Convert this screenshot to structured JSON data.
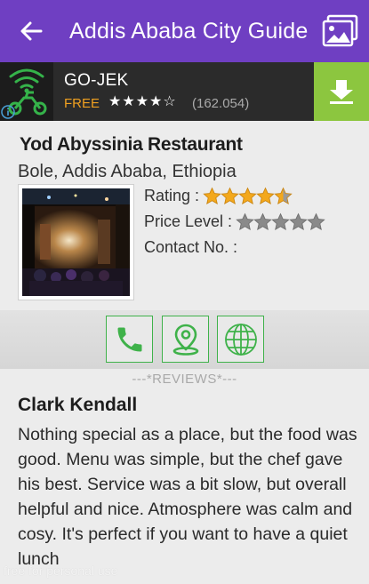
{
  "appbar": {
    "title": "Addis Ababa City Guide",
    "back_icon": "arrow-left-icon",
    "gallery_icon": "image-gallery-icon"
  },
  "ad": {
    "app_name": "GO-JEK",
    "price": "FREE",
    "stars": "★★★★☆",
    "rating_count": "(162.054)",
    "logo_icon": "gojek-scooter-logo",
    "download_icon": "download-icon",
    "accent_color": "#8cc63f"
  },
  "place": {
    "name": "Yod Abyssinia Restaurant",
    "address": "Bole, Addis Ababa, Ethiopia",
    "rating_label": "Rating :",
    "rating_value": 4.5,
    "rating_max": 5,
    "price_label": "Price Level :",
    "price_value": 0,
    "price_max": 5,
    "contact_label": "Contact No. :",
    "contact_value": ""
  },
  "actions": [
    {
      "name": "call",
      "icon": "phone-icon"
    },
    {
      "name": "map",
      "icon": "map-pin-icon"
    },
    {
      "name": "website",
      "icon": "globe-icon"
    }
  ],
  "reviews": {
    "header": "---*REVIEWS*---",
    "items": [
      {
        "author": "Clark Kendall",
        "text": "Nothing special as a place, but the food was good. Menu was simple, but the chef gave his best. Service was a bit slow, but overall helpful and nice. Atmosphere was calm and cosy. It's perfect if you want to have a quiet lunch"
      }
    ]
  },
  "watermark": "free for personal use",
  "colors": {
    "appbar": "#6f3fc2",
    "action_border": "#3fb24a",
    "star_gold": "#f3a81c",
    "star_gray": "#8a8a8a"
  }
}
